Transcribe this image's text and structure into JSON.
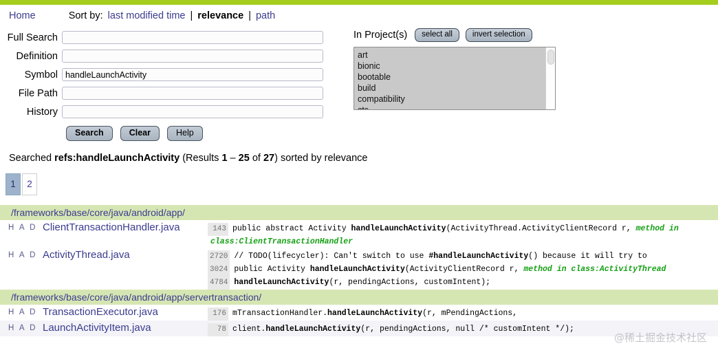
{
  "theme": {
    "topbar_color": "#a5cd1e",
    "link_color": "#3b3b8f",
    "dir_header_bg": "#d6e6b3",
    "meta_color": "#14a014",
    "active_page_bg": "#9db3cc"
  },
  "header": {
    "home_label": "Home",
    "sort_by_label": "Sort by:",
    "sort_options": [
      {
        "label": "last modified time",
        "current": false
      },
      {
        "label": "relevance",
        "current": true
      },
      {
        "label": "path",
        "current": false
      }
    ],
    "separator": "|"
  },
  "search_form": {
    "fields": [
      {
        "label": "Full Search",
        "value": "",
        "name": "full-search"
      },
      {
        "label": "Definition",
        "value": "",
        "name": "definition"
      },
      {
        "label": "Symbol",
        "value": "handleLaunchActivity",
        "name": "symbol"
      },
      {
        "label": "File Path",
        "value": "",
        "name": "file-path"
      },
      {
        "label": "History",
        "value": "",
        "name": "history"
      }
    ],
    "buttons": [
      {
        "label": "Search",
        "bold": true
      },
      {
        "label": "Clear",
        "bold": true
      },
      {
        "label": "Help",
        "bold": false
      }
    ]
  },
  "projects": {
    "title": "In Project(s)",
    "select_all_label": "select all",
    "invert_selection_label": "invert selection",
    "items": [
      "art",
      "bionic",
      "bootable",
      "build",
      "compatibility",
      "cts"
    ]
  },
  "summary": {
    "prefix": "Searched ",
    "query": "refs:handleLaunchActivity",
    "results_open": " (Results ",
    "range_start": "1",
    "dash": " – ",
    "range_end": "25",
    "of": " of ",
    "total": "27",
    "results_close": ") sorted by ",
    "sort": "relevance"
  },
  "pagination": {
    "pages": [
      {
        "label": "1",
        "active": true
      },
      {
        "label": "2",
        "active": false
      }
    ]
  },
  "results": {
    "had_label": "H A D",
    "groups": [
      {
        "directory": "/frameworks/base/core/java/android/app/",
        "files": [
          {
            "filename": "ClientTransactionHandler.java",
            "had": "H A D",
            "alt": false,
            "lines": [
              {
                "number": "143",
                "segments": [
                  {
                    "text": "public abstract Activity ",
                    "style": "plain"
                  },
                  {
                    "text": "handleLaunchActivity",
                    "style": "hl"
                  },
                  {
                    "text": "(ActivityThread.ActivityClientRecord r,",
                    "style": "plain"
                  },
                  {
                    "text": "   method in",
                    "style": "meta"
                  }
                ]
              },
              {
                "number": "",
                "continuation": true,
                "segments": [
                  {
                    "text": "class:ClientTransactionHandler",
                    "style": "meta"
                  }
                ]
              }
            ]
          },
          {
            "filename": "ActivityThread.java",
            "had": "H A D",
            "alt": false,
            "lines": [
              {
                "number": "2720",
                "segments": [
                  {
                    "text": "// TODO(lifecycler): Can't switch to use ",
                    "style": "plain"
                  },
                  {
                    "text": "#handleLaunchActivity",
                    "style": "hl"
                  },
                  {
                    "text": "() because it will try to",
                    "style": "plain"
                  }
                ]
              },
              {
                "number": "3024",
                "segments": [
                  {
                    "text": "public Activity ",
                    "style": "plain"
                  },
                  {
                    "text": "handleLaunchActivity",
                    "style": "hl"
                  },
                  {
                    "text": "(ActivityClientRecord r,",
                    "style": "plain"
                  },
                  {
                    "text": "   method in class:ActivityThread",
                    "style": "meta"
                  }
                ]
              },
              {
                "number": "4784",
                "segments": [
                  {
                    "text": "handleLaunchActivity",
                    "style": "hl"
                  },
                  {
                    "text": "(r, pendingActions, customIntent);",
                    "style": "plain"
                  }
                ]
              }
            ]
          }
        ]
      },
      {
        "directory": "/frameworks/base/core/java/android/app/servertransaction/",
        "files": [
          {
            "filename": "TransactionExecutor.java",
            "had": "H A D",
            "alt": false,
            "lines": [
              {
                "number": "176",
                "segments": [
                  {
                    "text": "mTransactionHandler.",
                    "style": "plain"
                  },
                  {
                    "text": "handleLaunchActivity",
                    "style": "hl"
                  },
                  {
                    "text": "(r, mPendingActions,",
                    "style": "plain"
                  }
                ]
              }
            ]
          },
          {
            "filename": "LaunchActivityItem.java",
            "had": "H A D",
            "alt": true,
            "lines": [
              {
                "number": "78",
                "segments": [
                  {
                    "text": "client.",
                    "style": "plain"
                  },
                  {
                    "text": "handleLaunchActivity",
                    "style": "hl"
                  },
                  {
                    "text": "(r, pendingActions, null /* customIntent */);",
                    "style": "plain"
                  }
                ]
              }
            ]
          }
        ]
      }
    ]
  },
  "watermark": {
    "text": "@稀土掘金技术社区"
  }
}
